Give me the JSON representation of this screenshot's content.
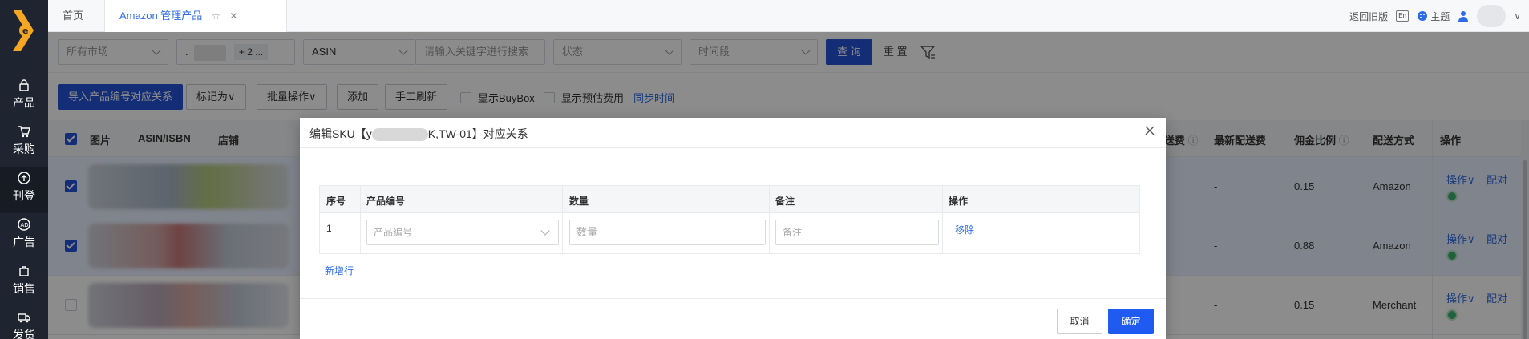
{
  "nav": {
    "items": [
      {
        "label": "产品",
        "icon": "lock-icon"
      },
      {
        "label": "采购",
        "icon": "cart-icon"
      },
      {
        "label": "刊登",
        "icon": "upload-icon"
      },
      {
        "label": "广告",
        "icon": "ad-icon"
      },
      {
        "label": "销售",
        "icon": "sales-icon"
      },
      {
        "label": "发货",
        "icon": "truck-icon"
      }
    ],
    "active_index": 2,
    "logo_color": "#f5a623"
  },
  "tabs": {
    "home": "首页",
    "active": "Amazon 管理产品"
  },
  "topbar": {
    "old_version": "返回旧版",
    "lang": "En",
    "theme": "主题"
  },
  "filters": {
    "market": "所有市场",
    "shop_prefix": ".",
    "shop_more": "+ 2 ...",
    "search_type": "ASIN",
    "search_placeholder": "请输入关键字进行搜索",
    "status": "状态",
    "time": "时间段",
    "query": "查 询",
    "reset": "重 置"
  },
  "toolbar": {
    "import": "导入产品编号对应关系",
    "mark": "标记为∨",
    "batch": "批量操作∨",
    "add": "添加",
    "refresh": "手工刷新",
    "show_buybox": "显示BuyBox",
    "show_fee": "显示预估费用",
    "sync": "同步时间"
  },
  "table": {
    "headers": {
      "image": "图片",
      "asin": "ASIN/ISBN",
      "shop": "店铺",
      "delivery_fee": "送费",
      "latest_fee": "最新配送费",
      "commission": "佣金比例",
      "ship": "配送方式",
      "action": "操作"
    },
    "rows": [
      {
        "selected": true,
        "latest_fee": "-",
        "commission": "0.15",
        "ship": "Amazon",
        "op": "操作∨",
        "match": "配对"
      },
      {
        "selected": true,
        "latest_fee": "-",
        "commission": "0.88",
        "ship": "Amazon",
        "op": "操作∨",
        "match": "配对"
      },
      {
        "selected": false,
        "latest_fee": "-",
        "commission": "0.15",
        "ship": "Merchant",
        "op": "操作∨",
        "match": "配对"
      }
    ]
  },
  "dialog": {
    "title_prefix": "编辑SKU【y",
    "title_suffix": "K,TW-01】对应关系",
    "headers": {
      "seq": "序号",
      "product_no": "产品编号",
      "qty": "数量",
      "note": "备注",
      "op": "操作"
    },
    "row": {
      "seq": "1",
      "product_placeholder": "产品编号",
      "qty_placeholder": "数量",
      "note_placeholder": "备注",
      "remove": "移除"
    },
    "add_row": "新增行",
    "cancel": "取消",
    "ok": "确定"
  },
  "colors": {
    "primary": "#2454d8",
    "link": "#2f6be8",
    "nav_bg": "#1f2530"
  }
}
